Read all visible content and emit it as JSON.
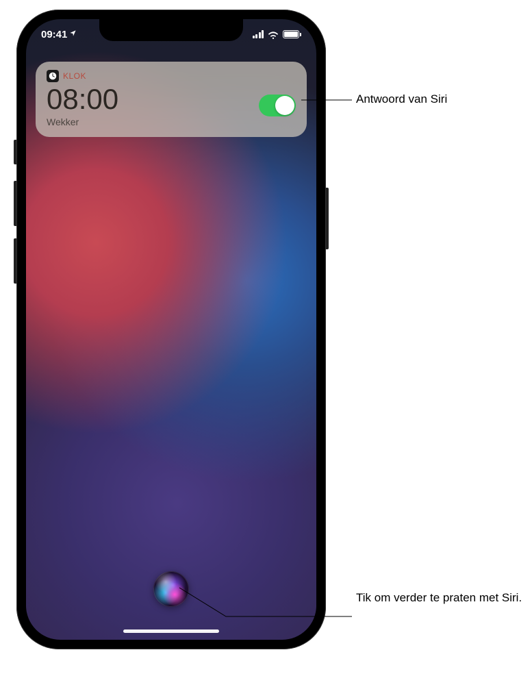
{
  "status_bar": {
    "time": "09:41"
  },
  "siri_response": {
    "app_name": "KLOK",
    "alarm_time": "08:00",
    "alarm_label": "Wekker"
  },
  "callouts": {
    "siri_response": "Antwoord van Siri",
    "siri_continue": "Tik om verder te praten met Siri."
  }
}
